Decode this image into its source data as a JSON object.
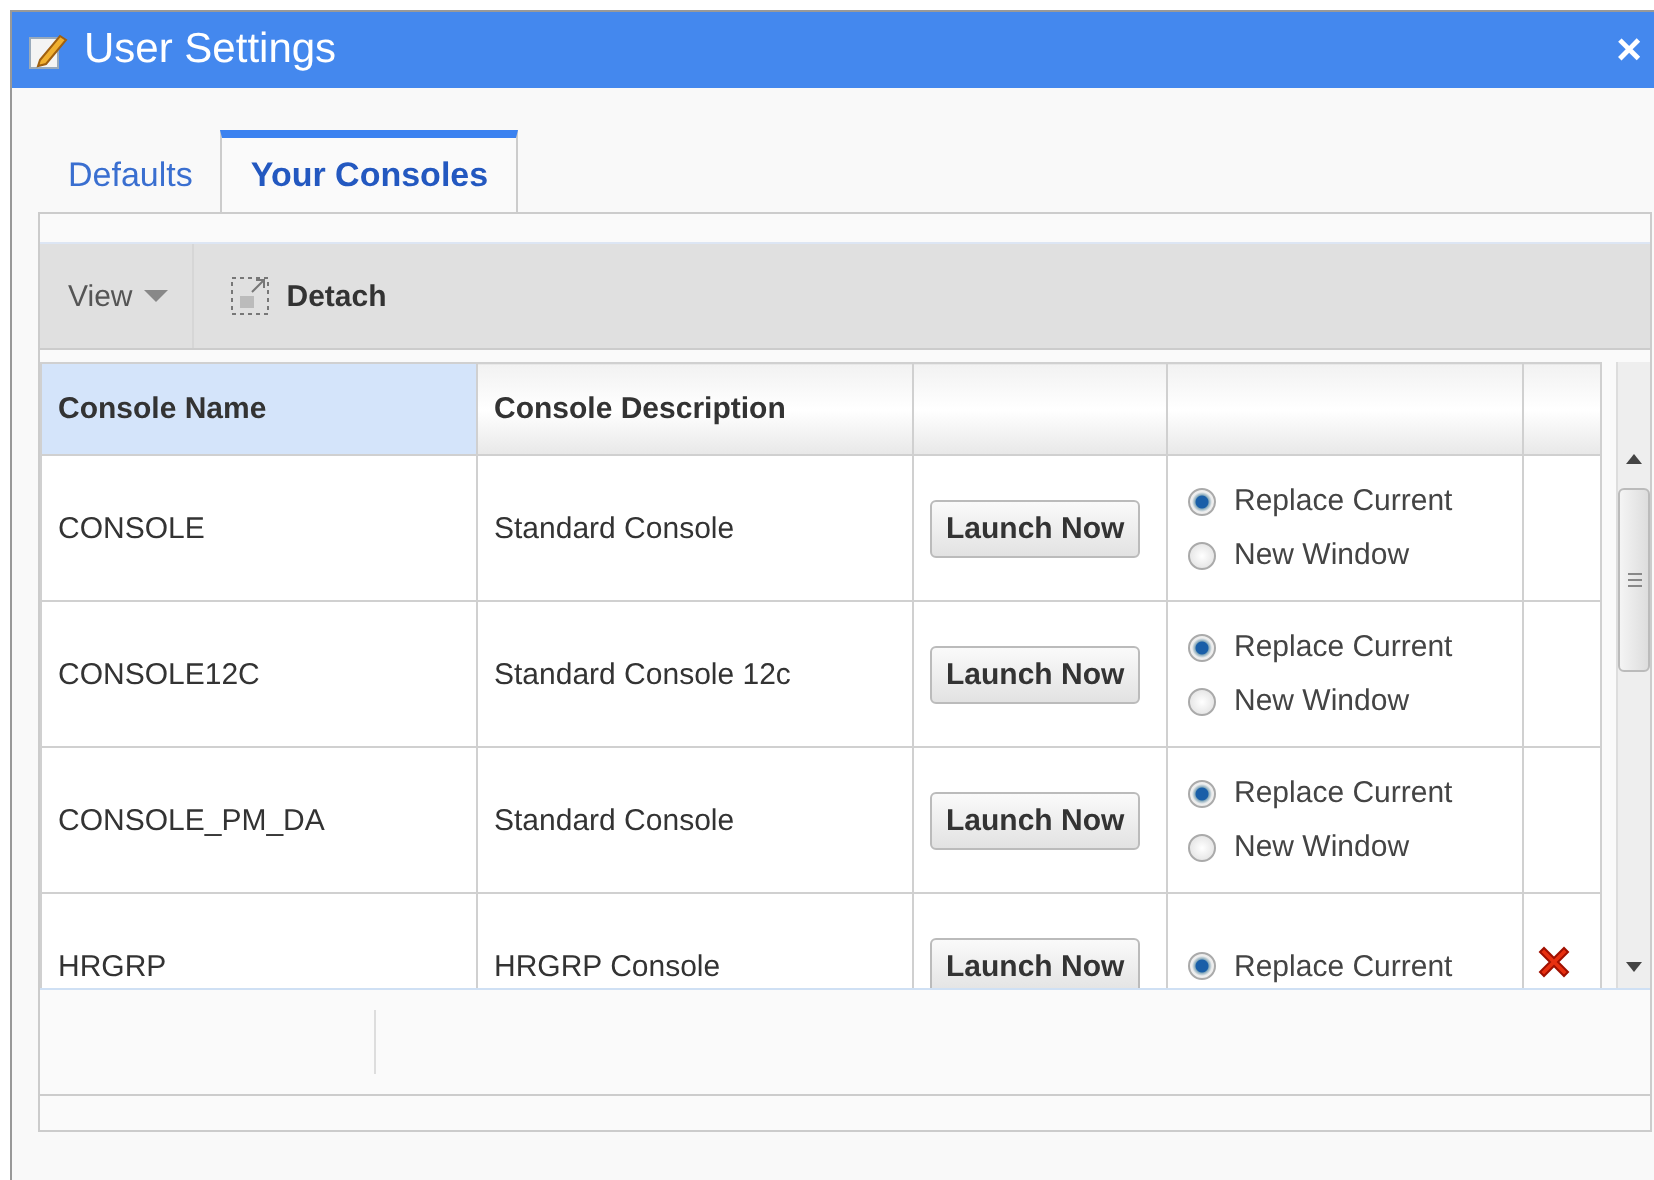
{
  "window": {
    "title": "User Settings",
    "close": "×"
  },
  "tabs": [
    {
      "label": "Defaults",
      "selected": false
    },
    {
      "label": "Your Consoles",
      "selected": true
    }
  ],
  "toolbar": {
    "view": "View",
    "detach": "Detach"
  },
  "table": {
    "columns": [
      "Console Name",
      "Console Description"
    ],
    "rows": [
      {
        "name": "CONSOLE",
        "description": "Standard Console",
        "button": "Launch Now",
        "deletable": false,
        "options": [
          {
            "label": "Replace Current",
            "selected": true
          },
          {
            "label": "New Window",
            "selected": false
          }
        ]
      },
      {
        "name": "CONSOLE12C",
        "description": "Standard Console 12c",
        "button": "Launch Now",
        "deletable": false,
        "options": [
          {
            "label": "Replace Current",
            "selected": true
          },
          {
            "label": "New Window",
            "selected": false
          }
        ]
      },
      {
        "name": "CONSOLE_PM_DA",
        "description": "Standard Console",
        "button": "Launch Now",
        "deletable": false,
        "options": [
          {
            "label": "Replace Current",
            "selected": true
          },
          {
            "label": "New Window",
            "selected": false
          }
        ]
      },
      {
        "name": "HRGRP",
        "description": "HRGRP Console",
        "button": "Launch Now",
        "deletable": true,
        "options": [
          {
            "label": "Replace Current",
            "selected": true
          }
        ]
      }
    ]
  }
}
